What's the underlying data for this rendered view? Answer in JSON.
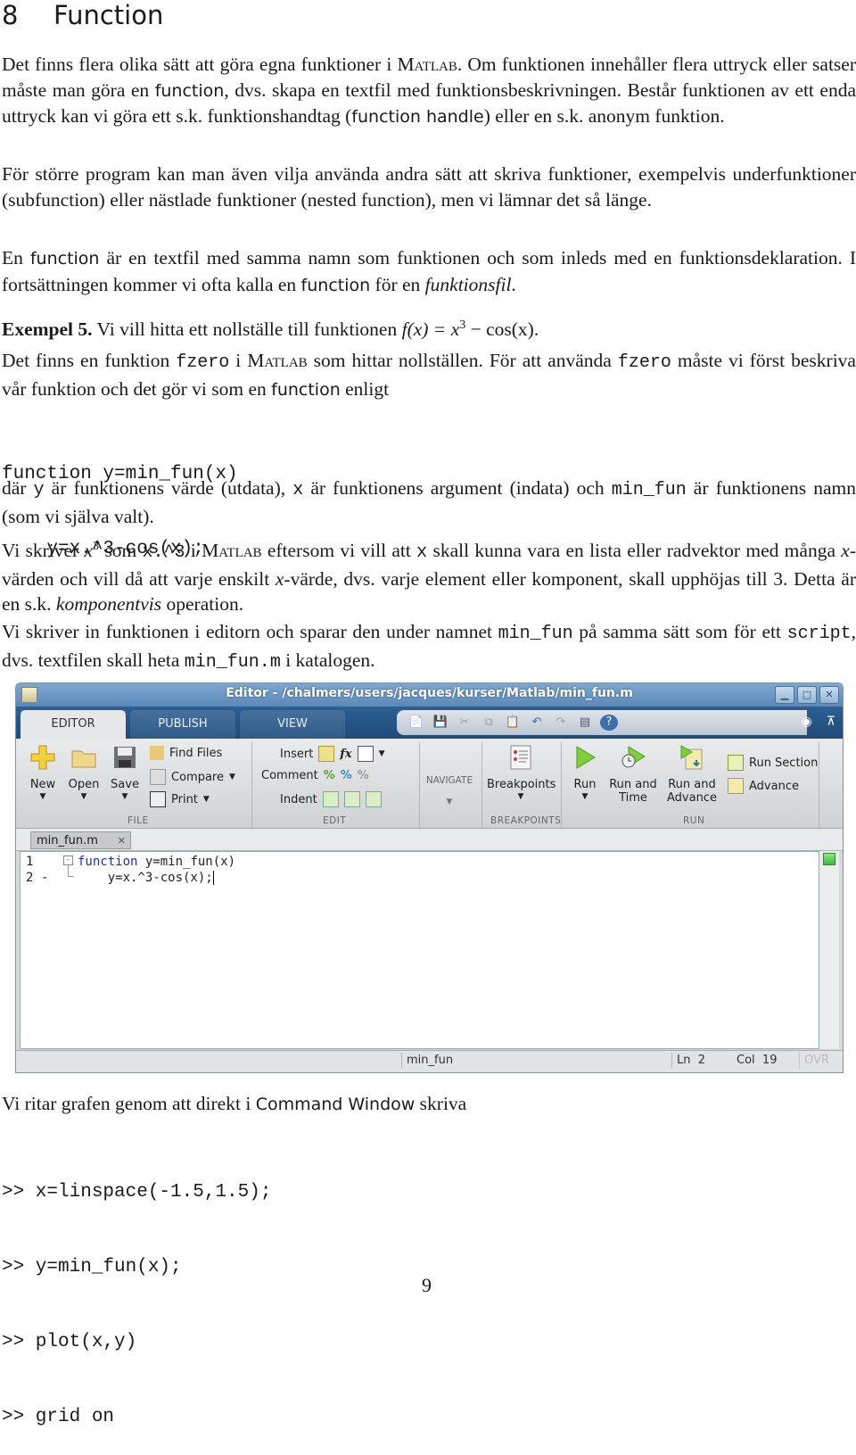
{
  "section": {
    "number": "8",
    "title": "Function"
  },
  "p1": {
    "a": "Det finns flera olika sätt att göra egna funktioner i ",
    "matlab": "Matlab",
    "b": ". Om funktionen innehåller flera uttryck eller satser måste man göra en ",
    "function": "function",
    "c": ", dvs. skapa en textfil med funktionsbeskrivningen. Består funktionen av ett enda uttryck kan vi göra ett s.k. funktionshandtag (",
    "handle": "function handle",
    "d": ") eller en s.k. anonym funktion."
  },
  "p2": "För större program kan man även vilja använda andra sätt att skriva funktioner, exempelvis underfunktioner (subfunction) eller nästlade funktioner (nested function), men vi lämnar det så länge.",
  "p3": {
    "a": "En ",
    "function": "function",
    "b": " är en textfil med samma namn som funktionen och som inleds med en funktionsdeklaration. I fortsättningen kommer vi ofta kalla en ",
    "c": " för en ",
    "italic": "funktionsfil",
    "d": "."
  },
  "example": {
    "label": "Exempel 5.",
    "text": " Vi vill hitta ett nollställe till funktionen ",
    "formula_lhs": "f(x) = x",
    "formula_exp": "3",
    "formula_rhs": " − cos(x)."
  },
  "p4": {
    "a": "Det finns en funktion ",
    "fzero": "fzero",
    "b": " i ",
    "matlab": "Matlab",
    "c": " som hittar nollställen. För att använda ",
    "d": " måste vi först beskriva vår funktion och det gör vi som en ",
    "function": "function",
    "e": " enligt"
  },
  "code1": [
    "function y=min_fun(x)",
    "    y=x.^3-cos(x);"
  ],
  "p5": {
    "a": "där ",
    "y": "y",
    "b": " är funktionens värde (utdata), ",
    "x": "x",
    "c": " är funktionens argument (indata) och ",
    "min_fun": "min_fun",
    "d": " är funktionens namn (som vi själva valt)."
  },
  "p6": {
    "a": "Vi skriver ",
    "x3": "x",
    "exp": "3",
    "b": " som ",
    "code": "x.^3",
    "c": " i ",
    "matlab": "Matlab",
    "d": " eftersom vi vill att ",
    "x": "x",
    "e": " skall kunna vara en lista eller radvektor med många ",
    "xi": "x",
    "f": "-värden och vill då att varje enskilt ",
    "g": "-värde, dvs. varje element eller komponent, skall upphöjas till 3. Detta är en s.k. ",
    "italic": "komponentvis",
    "h": " operation."
  },
  "p7": {
    "a": "Vi skriver in funktionen i editorn och sparar den under namnet ",
    "min_fun": "min_fun",
    "b": " på samma sätt som för ett ",
    "script": "script",
    "c": ", dvs. textfilen skall heta ",
    "file": "min_fun.m",
    "d": " i katalogen."
  },
  "editor": {
    "title": "Editor - /chalmers/users/jacques/kurser/Matlab/min_fun.m",
    "tabs": [
      "EDITOR",
      "PUBLISH",
      "VIEW"
    ],
    "groups": [
      "FILE",
      "EDIT",
      "NAVIGATE",
      "BREAKPOINTS",
      "RUN"
    ],
    "file_buttons": [
      "New",
      "Open",
      "Save"
    ],
    "file_small": [
      "Find Files",
      "Compare",
      "Print"
    ],
    "edit_labels": [
      "Insert",
      "Comment",
      "Indent"
    ],
    "breakpoints": "Breakpoints",
    "run": "Run",
    "run_time": [
      "Run and",
      "Time"
    ],
    "run_advance": [
      "Run and",
      "Advance"
    ],
    "run_section": "Run Section",
    "advance": "Advance",
    "doc_tab": "min_fun.m",
    "lines": [
      {
        "no": "1",
        "kw": "function",
        "rest": " y=min_fun(x)"
      },
      {
        "no": "2 -",
        "text": "    y=x.^3-cos(x);"
      }
    ],
    "status": {
      "name": "min_fun",
      "ln_label": "Ln",
      "ln": "2",
      "col_label": "Col",
      "col": "19",
      "ovr": "OVR"
    },
    "accent": "#1f4b7a"
  },
  "p8": {
    "a": "Vi ritar grafen genom att direkt i ",
    "cw": "Command Window",
    "b": " skriva"
  },
  "code2": [
    ">> x=linspace(-1.5,1.5);",
    ">> y=min_fun(x);",
    ">> plot(x,y)",
    ">> grid on"
  ],
  "page_number": "9"
}
